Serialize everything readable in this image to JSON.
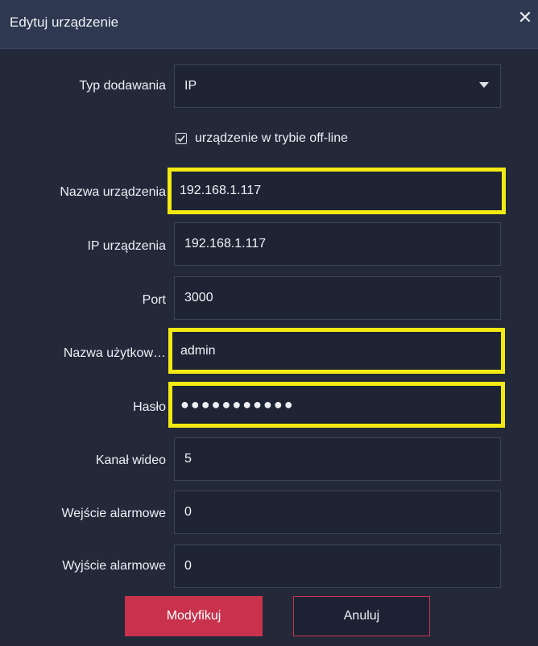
{
  "dialog": {
    "title": "Edytuj urządzenie",
    "close_icon": "close-icon"
  },
  "form": {
    "add_type": {
      "label": "Typ dodawania",
      "value": "IP"
    },
    "offline_checkbox": {
      "label": "urządzenie w trybie off-line",
      "checked": true
    },
    "device_name": {
      "label": "Nazwa urządzenia",
      "value": "192.168.1.117"
    },
    "device_ip": {
      "label": "IP urządzenia",
      "value": "192.168.1.117"
    },
    "port": {
      "label": "Port",
      "value": "3000"
    },
    "username": {
      "label": "Nazwa użytkow…",
      "value": "admin"
    },
    "password": {
      "label": "Hasło",
      "value": "●●●●●●●●●●●"
    },
    "video_channel": {
      "label": "Kanał wideo",
      "value": "5"
    },
    "alarm_input": {
      "label": "Wejście alarmowe",
      "value": "0"
    },
    "alarm_output": {
      "label": "Wyjście alarmowe",
      "value": "0"
    }
  },
  "buttons": {
    "modify": "Modyfikuj",
    "cancel": "Anuluj"
  },
  "colors": {
    "highlight": "#f2ea12",
    "accent": "#c8324c",
    "background": "#232939"
  }
}
